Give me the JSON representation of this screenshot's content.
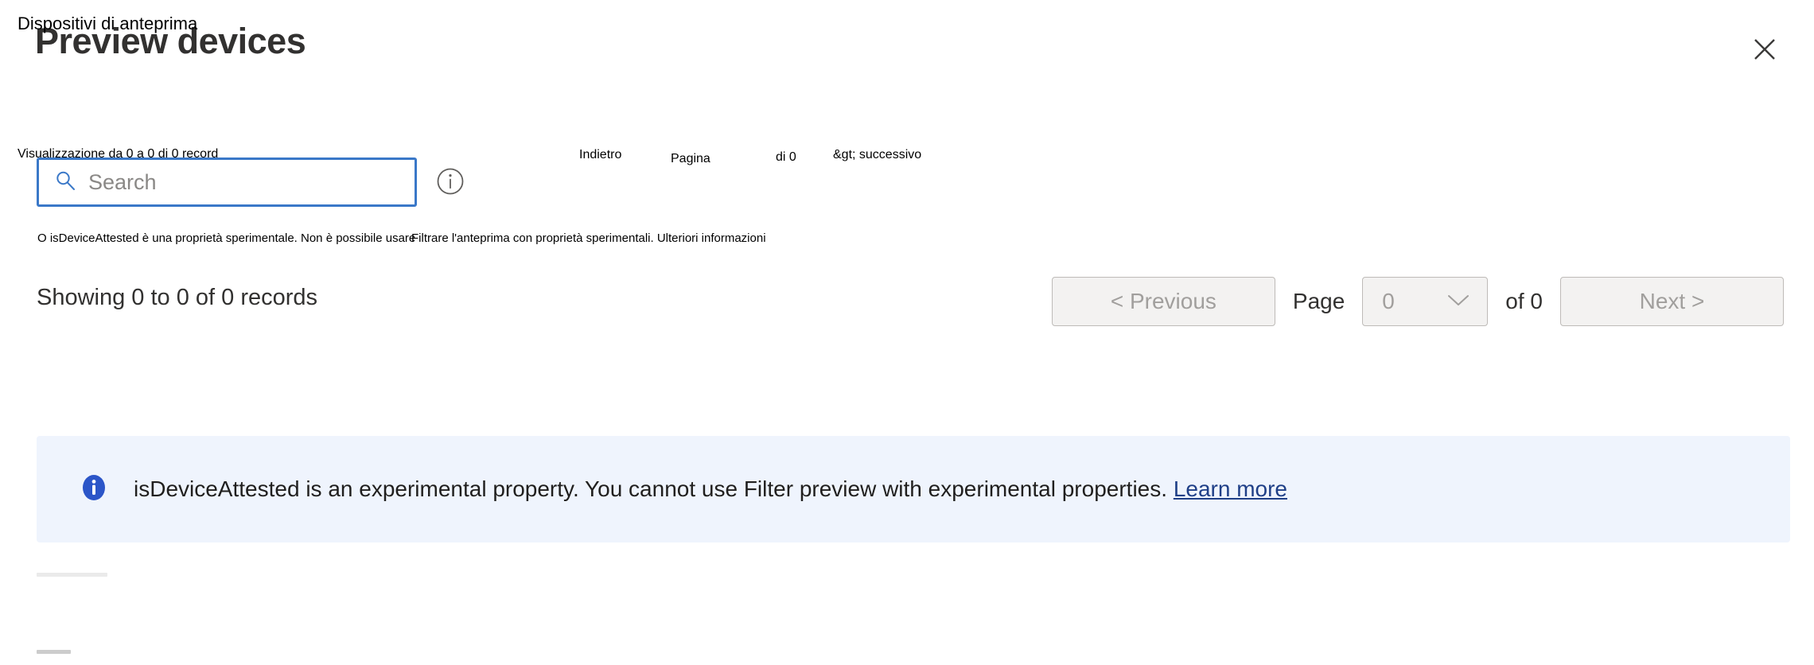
{
  "header": {
    "title": "Preview devices",
    "close_label": "Close",
    "close_icon": "close-icon"
  },
  "localization_notes": {
    "title": "Dispositivi di anteprima",
    "showing_records": "Visualizzazione da 0 a 0 di 0 record",
    "previous": "Indietro",
    "page": "Pagina",
    "of": "di 0",
    "next": "&gt; successivo",
    "banner_part1": "O isDeviceAttested è una proprietà sperimentale. Non è possibile usare",
    "banner_part2": "Filtrare l'anteprima con proprietà sperimentali. Ulteriori informazioni"
  },
  "search": {
    "value": "",
    "placeholder": "Search",
    "icon": "search-icon",
    "info_icon": "info-circle-icon"
  },
  "records": {
    "count_text": "Showing 0 to 0 of 0 records"
  },
  "pagination": {
    "previous_label": "< Previous",
    "page_label": "Page",
    "page_value": "0",
    "page_chevron_icon": "chevron-down-icon",
    "of_label": "of 0",
    "next_label": "Next >"
  },
  "banner": {
    "icon": "info-filled-icon",
    "message": "isDeviceAttested is an experimental property. You cannot use Filter preview with experimental properties.",
    "link_label": "Learn more",
    "background_color": "#eff4fd",
    "icon_color": "#2b55c8",
    "link_color": "#1f3f87"
  },
  "colors": {
    "accent_blue": "#3a78c8",
    "text_primary": "#323130",
    "text_disabled": "#a19f9d",
    "control_background": "#f3f2f1"
  }
}
